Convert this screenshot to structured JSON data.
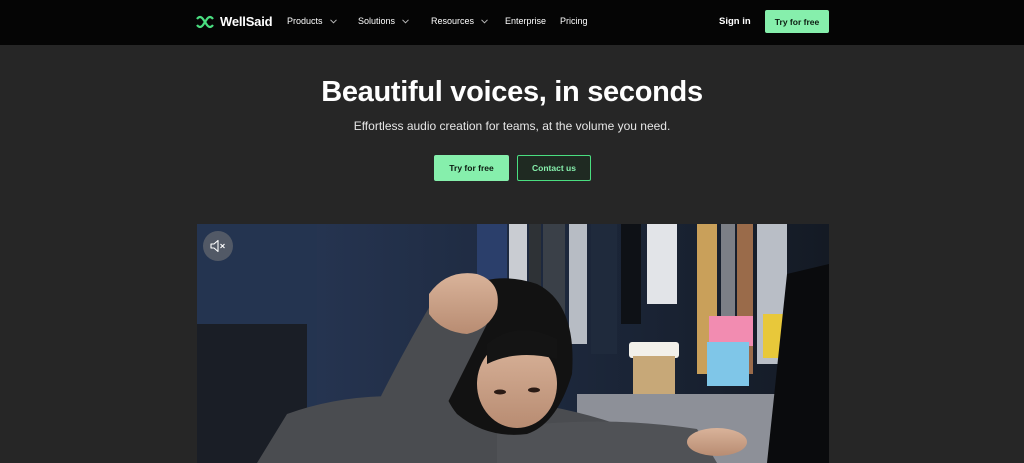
{
  "nav": {
    "logo_text": "WellSaid",
    "items": [
      {
        "label": "Products",
        "dropdown": true
      },
      {
        "label": "Solutions",
        "dropdown": true
      },
      {
        "label": "Resources",
        "dropdown": true
      },
      {
        "label": "Enterprise",
        "dropdown": false
      },
      {
        "label": "Pricing",
        "dropdown": false
      }
    ],
    "signin_label": "Sign in",
    "cta_label": "Try for free"
  },
  "hero": {
    "title": "Beautiful voices, in seconds",
    "subtitle": "Effortless audio creation for teams, at the volume you need.",
    "primary_button": "Try for free",
    "secondary_button": "Contact us"
  },
  "video": {
    "mute_icon": "speaker-muted-icon",
    "scene": "woman at desk holding head, office shelves, coffee cup, sticky notes"
  },
  "colors": {
    "background": "#262626",
    "nav_background": "#050505",
    "accent_green": "#86efac",
    "accent_border": "#4ade80"
  }
}
